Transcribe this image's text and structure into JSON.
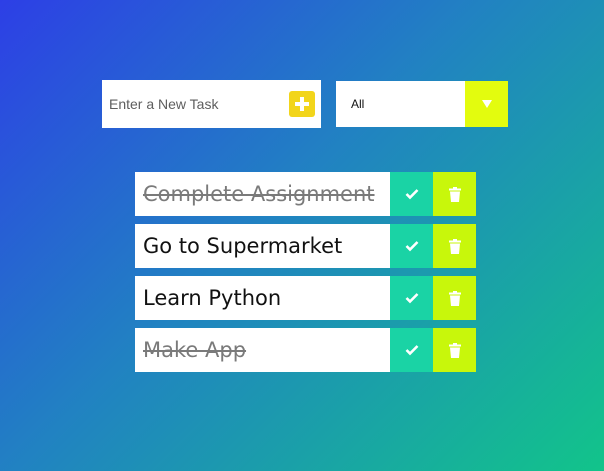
{
  "form": {
    "input_placeholder": "Enter a New Task",
    "input_value": "",
    "add_button_icon": "plus-square-icon"
  },
  "filter": {
    "selected": "All",
    "toggle_icon": "caret-down-icon"
  },
  "todos": [
    {
      "text": "Complete Assignment",
      "completed": true
    },
    {
      "text": "Go to Supermarket",
      "completed": false
    },
    {
      "text": "Learn Python",
      "completed": false
    },
    {
      "text": "Make App",
      "completed": true
    }
  ],
  "icons": {
    "check": "check-icon",
    "trash": "trash-icon"
  },
  "colors": {
    "background_start": "#2d3fe6",
    "background_end": "#12c48a",
    "add_button": "#f2d51b",
    "filter_toggle": "#e3fc0e",
    "check_button": "#1ad3a5",
    "trash_button": "#c8f70b"
  }
}
